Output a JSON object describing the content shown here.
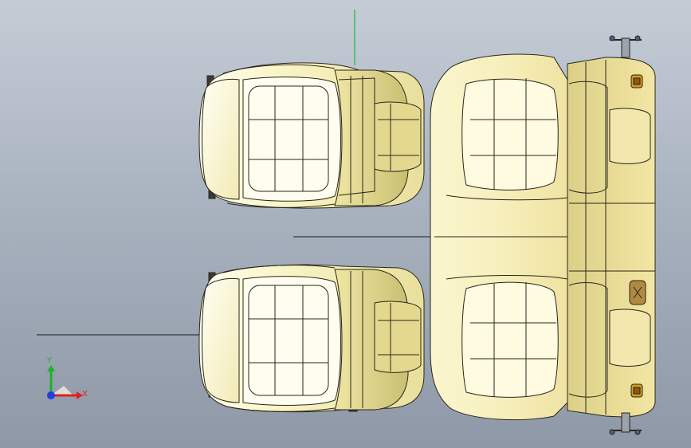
{
  "viewport": {
    "background_top": "#c5ccd6",
    "background_bottom": "#8e98a6"
  },
  "model": {
    "fill_color": "#f6f0b4",
    "highlight_color": "#fffef0",
    "shade_color": "#d8cf84",
    "edge_color": "#2a2618",
    "objects": [
      "front-seat-left",
      "front-seat-right",
      "rear-bench-seat"
    ]
  },
  "triad": {
    "x_label": "X",
    "y_label": "Y",
    "x_color": "#e02020",
    "y_color": "#20b030",
    "z_color": "#2040e0"
  },
  "reference_axis_color": "#10c040"
}
